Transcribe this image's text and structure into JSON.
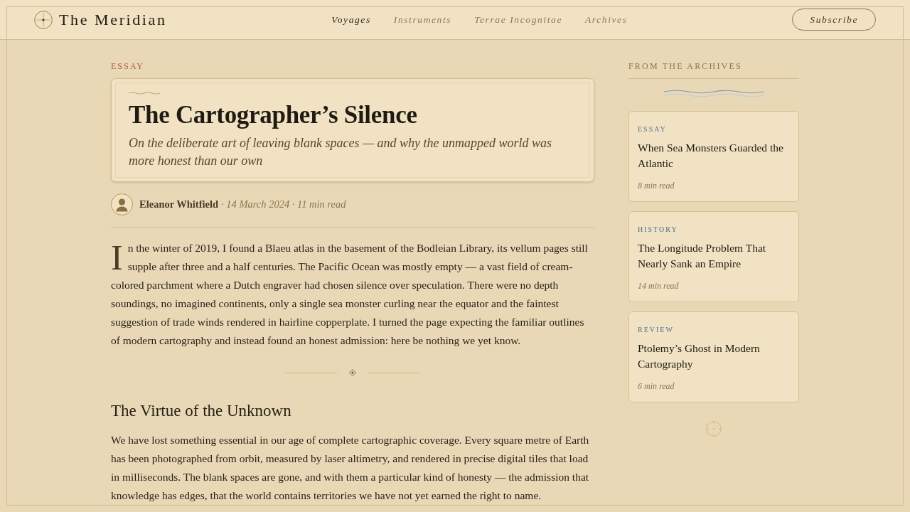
{
  "header": {
    "brand": "The Meridian",
    "nav": [
      {
        "label": "Voyages",
        "selected": true
      },
      {
        "label": "Instruments",
        "selected": false
      },
      {
        "label": "Terrae Incognitae",
        "selected": false
      },
      {
        "label": "Archives",
        "selected": false
      }
    ],
    "subscribe": "Subscribe"
  },
  "article": {
    "kicker": "ESSAY",
    "title": "The Cartographer’s Silence",
    "subtitle": "On the deliberate art of leaving blank spaces — and why the unmapped world was more honest than our own",
    "byline": {
      "author": "Eleanor Whitfield",
      "details": "· 14 March 2024 · 11 min read"
    },
    "blocks": [
      {
        "kind": "paragraph",
        "drop_cap": true,
        "text": "In the winter of 2019, I found a Blaeu atlas in the basement of the Bodleian Library, its vellum pages still supple after three and a half centuries. The Pacific Ocean was mostly empty — a vast field of cream-colored parchment where a Dutch engraver had chosen silence over speculation. There were no depth soundings, no imagined continents, only a single sea monster curling near the equator and the faintest suggestion of trade winds rendered in hairline copperplate. I turned the page expecting the familiar outlines of modern cartography and instead found an honest admission: here be nothing we yet know."
      },
      {
        "kind": "ornament"
      },
      {
        "kind": "heading",
        "text": "The Virtue of the Unknown"
      },
      {
        "kind": "paragraph",
        "drop_cap": false,
        "text": "We have lost something essential in our age of complete cartographic coverage. Every square metre of Earth has been photographed from orbit, measured by laser altimetry, and rendered in precise digital tiles that load in milliseconds. The blank spaces are gone, and with them a particular kind of honesty — the admission that knowledge has edges, that the world contains territories we have not yet earned the right to name."
      }
    ]
  },
  "sidebar": {
    "heading": "FROM THE ARCHIVES",
    "cards": [
      {
        "kicker": "ESSAY",
        "title": "When Sea Monsters Guarded the Atlantic",
        "meta": "8 min read"
      },
      {
        "kicker": "HISTORY",
        "title": "The Longitude Problem That Nearly Sank an Empire",
        "meta": "14 min read"
      },
      {
        "kicker": "REVIEW",
        "title": "Ptolemy’s Ghost in Modern Cartography",
        "meta": "6 min read"
      }
    ]
  }
}
